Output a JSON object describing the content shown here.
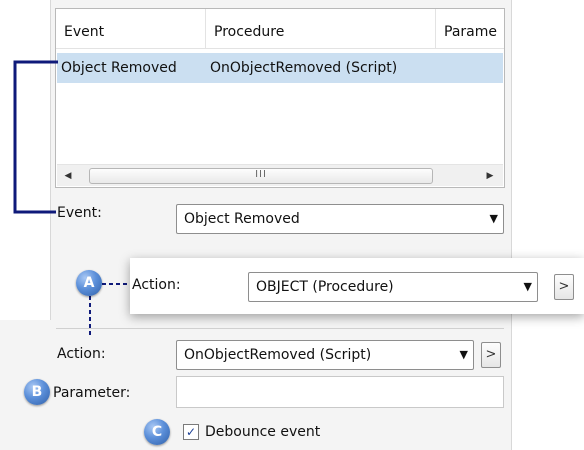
{
  "list": {
    "columns": [
      "Event",
      "Procedure",
      "Parame"
    ],
    "rows": [
      {
        "event": "Object Removed",
        "procedure": "OnObjectRemoved (Script)",
        "parameter": ""
      }
    ],
    "scroll_thumb_grip": "III"
  },
  "event_field": {
    "label": "Event:",
    "value": "Object Removed"
  },
  "callouts": {
    "a": "A",
    "b": "B",
    "c": "C"
  },
  "action_popup": {
    "label": "Action:",
    "value": "OBJECT (Procedure)",
    "side_button": ">"
  },
  "action_field": {
    "label": "Action:",
    "value": "OnObjectRemoved (Script)",
    "side_button": ">"
  },
  "parameter_field": {
    "label": "Parameter:",
    "value": ""
  },
  "debounce": {
    "label": "Debounce event",
    "checked": true
  },
  "colors": {
    "selection": "#cbdff1",
    "callout": "#4a7fcc",
    "connector": "#0f1a7a"
  }
}
